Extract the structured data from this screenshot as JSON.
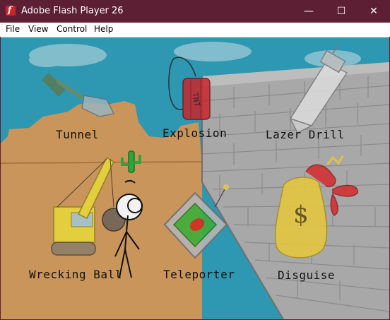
{
  "window": {
    "title": "Adobe Flash Player 26",
    "app_icon_glyph": "f",
    "titlebar_color": "#5c1f34",
    "controls": {
      "minimize": "—",
      "maximize": "☐",
      "close": "✕"
    }
  },
  "menu": {
    "items": [
      "File",
      "View",
      "Control",
      "Help"
    ]
  },
  "game": {
    "options": [
      {
        "label": "Tunnel",
        "icon": "shovel-icon"
      },
      {
        "label": "Explosion",
        "icon": "dynamite-icon"
      },
      {
        "label": "Lazer Drill",
        "icon": "drill-icon"
      },
      {
        "label": "Wrecking Ball",
        "icon": "crane-icon"
      },
      {
        "label": "Teleporter",
        "icon": "teleporter-icon"
      },
      {
        "label": "Disguise",
        "icon": "money-bag-icon"
      }
    ],
    "dynamite_text": "TNT",
    "money_symbol": "$",
    "colors": {
      "sky": "#2e97b1",
      "sand": "#c9955a",
      "wall": "#a5a5a5",
      "cactus": "#2fa43c"
    }
  }
}
